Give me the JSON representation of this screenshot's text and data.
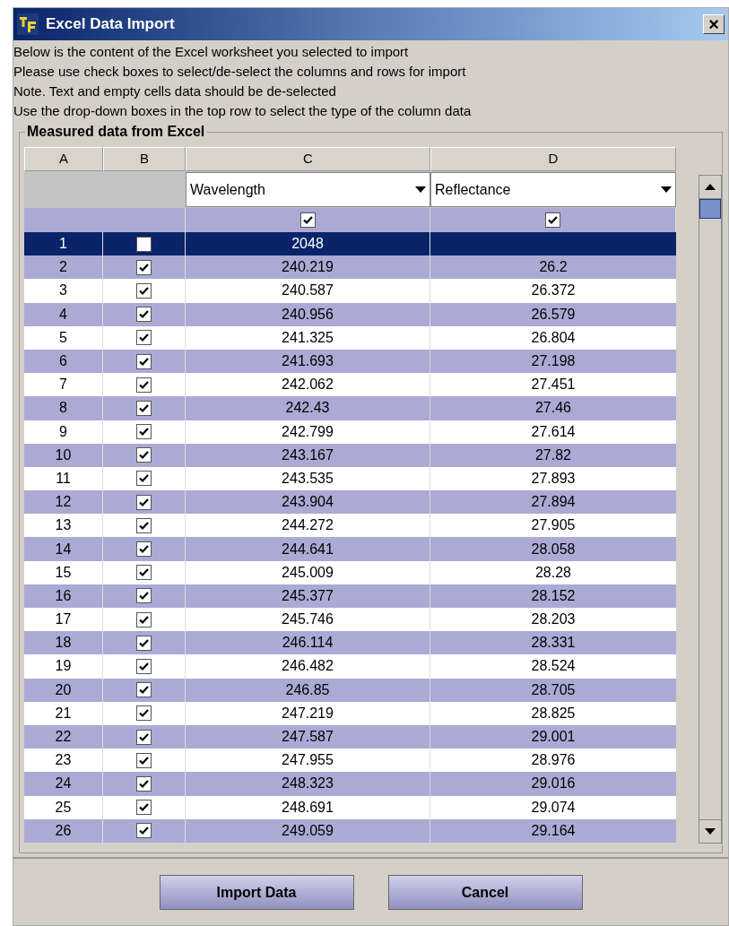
{
  "window": {
    "title": "Excel Data Import",
    "close": "×"
  },
  "instructions": [
    "Below is the content of the Excel worksheet you selected to import",
    "Please use check boxes to select/de-select the columns and rows for import",
    "Note. Text and empty cells data should be de-selected",
    "Use the drop-down boxes in the top row to select the type of the column data"
  ],
  "group_title": "Measured data from Excel",
  "table": {
    "columns": [
      "A",
      "B",
      "C",
      "D"
    ],
    "column_types": [
      {
        "value": "Wavelength",
        "checked": true
      },
      {
        "value": "Reflectance",
        "checked": true
      }
    ],
    "rows": [
      {
        "a": "1",
        "checked": false,
        "c": "2048",
        "selected": true
      },
      {
        "a": "2",
        "checked": true,
        "c": "240.219",
        "d": "26.2",
        "selected": false
      },
      {
        "a": "3",
        "checked": true,
        "c": "240.587",
        "d": "26.372",
        "selected": false
      },
      {
        "a": "4",
        "checked": true,
        "c": "240.956",
        "d": "26.579",
        "selected": false
      },
      {
        "a": "5",
        "checked": true,
        "c": "241.325",
        "d": "26.804",
        "selected": false
      },
      {
        "a": "6",
        "checked": true,
        "c": "241.693",
        "d": "27.198",
        "selected": false
      },
      {
        "a": "7",
        "checked": true,
        "c": "242.062",
        "d": "27.451",
        "selected": false
      },
      {
        "a": "8",
        "checked": true,
        "c": "242.43",
        "d": "27.46",
        "selected": false
      },
      {
        "a": "9",
        "checked": true,
        "c": "242.799",
        "d": "27.614",
        "selected": false
      },
      {
        "a": "10",
        "checked": true,
        "c": "243.167",
        "d": "27.82",
        "selected": false
      },
      {
        "a": "11",
        "checked": true,
        "c": "243.535",
        "d": "27.893",
        "selected": false
      },
      {
        "a": "12",
        "checked": true,
        "c": "243.904",
        "d": "27.894",
        "selected": false
      },
      {
        "a": "13",
        "checked": true,
        "c": "244.272",
        "d": "27.905",
        "selected": false
      },
      {
        "a": "14",
        "checked": true,
        "c": "244.641",
        "d": "28.058",
        "selected": false
      },
      {
        "a": "15",
        "checked": true,
        "c": "245.009",
        "d": "28.28",
        "selected": false
      },
      {
        "a": "16",
        "checked": true,
        "c": "245.377",
        "d": "28.152",
        "selected": false
      },
      {
        "a": "17",
        "checked": true,
        "c": "245.746",
        "d": "28.203",
        "selected": false
      },
      {
        "a": "18",
        "checked": true,
        "c": "246.114",
        "d": "28.331",
        "selected": false
      },
      {
        "a": "19",
        "checked": true,
        "c": "246.482",
        "d": "28.524",
        "selected": false
      },
      {
        "a": "20",
        "checked": true,
        "c": "246.85",
        "d": "28.705",
        "selected": false
      },
      {
        "a": "21",
        "checked": true,
        "c": "247.219",
        "d": "28.825",
        "selected": false
      },
      {
        "a": "22",
        "checked": true,
        "c": "247.587",
        "d": "29.001",
        "selected": false
      },
      {
        "a": "23",
        "checked": true,
        "c": "247.955",
        "d": "28.976",
        "selected": false
      },
      {
        "a": "24",
        "checked": true,
        "c": "248.323",
        "d": "29.016",
        "selected": false
      },
      {
        "a": "25",
        "checked": true,
        "c": "248.691",
        "d": "29.074",
        "selected": false
      },
      {
        "a": "26",
        "checked": true,
        "c": "249.059",
        "d": "29.164",
        "selected": false
      }
    ]
  },
  "buttons": [
    "Import Data",
    "Cancel"
  ]
}
